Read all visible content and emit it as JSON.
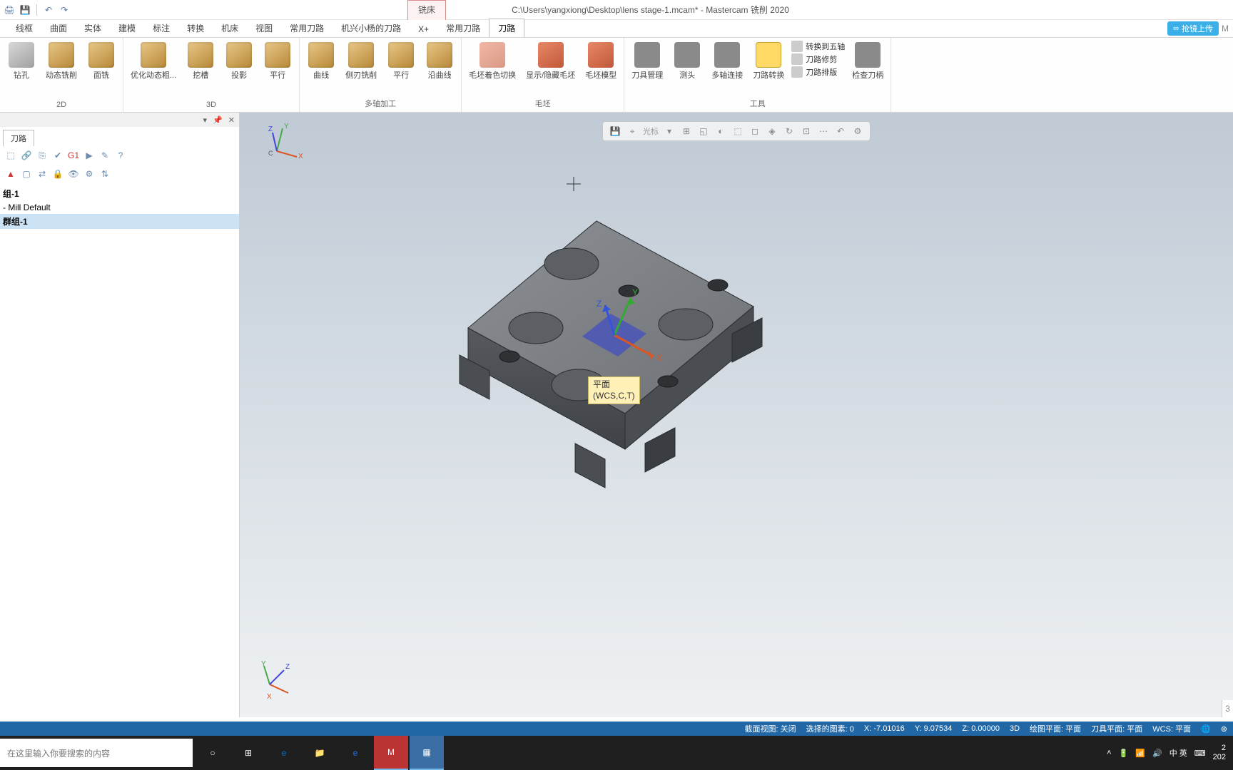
{
  "title": "C:\\Users\\yangxiong\\Desktop\\lens stage-1.mcam* - Mastercam 铣削 2020",
  "context_tab": "铣床",
  "tabs": [
    "线框",
    "曲面",
    "实体",
    "建模",
    "标注",
    "转换",
    "机床",
    "视图",
    "常用刀路",
    "机兴小杨的刀路",
    "X+",
    "常用刀路",
    "刀路"
  ],
  "active_tab": "刀路",
  "upload_button": "抢镜上传",
  "ribbon": {
    "group_2d": {
      "label": "2D",
      "buttons": [
        {
          "label": "钻孔"
        },
        {
          "label": "动态铣削"
        },
        {
          "label": "面铣"
        }
      ]
    },
    "group_3d": {
      "label": "3D",
      "buttons": [
        {
          "label": "优化动态粗..."
        },
        {
          "label": "挖槽"
        },
        {
          "label": "投影"
        },
        {
          "label": "平行"
        }
      ]
    },
    "group_multi": {
      "label": "多轴加工",
      "buttons": [
        {
          "label": "曲线"
        },
        {
          "label": "侧刃铣削"
        },
        {
          "label": "平行"
        },
        {
          "label": "沿曲线"
        }
      ]
    },
    "group_stock": {
      "label": "毛坯",
      "buttons": [
        {
          "label": "毛坯着色切换"
        },
        {
          "label": "显示/隐藏毛坯"
        },
        {
          "label": "毛坯模型"
        }
      ]
    },
    "group_tools": {
      "label": "工具",
      "buttons": [
        {
          "label": "刀具管理"
        },
        {
          "label": "测头"
        },
        {
          "label": "多轴连接"
        },
        {
          "label": "刀路转换"
        }
      ],
      "small": [
        {
          "label": "转换到五轴"
        },
        {
          "label": "刀路修剪"
        },
        {
          "label": "刀路排版"
        }
      ],
      "check": {
        "label": "检查刀柄"
      }
    }
  },
  "panel": {
    "tab": "刀路",
    "tree": [
      {
        "label": "组-1",
        "bold": true
      },
      {
        "label": " - Mill Default"
      },
      {
        "label": "群组-1",
        "bold": true,
        "sel": true
      }
    ]
  },
  "viewport": {
    "plane_label_1": "平面",
    "plane_label_2": "(WCS,C,T)",
    "toolbar_label": "光标",
    "ruler": "3"
  },
  "status": {
    "section_view": "截面视图: 关闭",
    "selected": "选择的图素: 0",
    "x": "X: -7.01016",
    "y": "Y: 9.07534",
    "z": "Z: 0.00000",
    "mode": "3D",
    "cplane": "绘图平面: 平面",
    "tplane": "刀具平面: 平面",
    "wcs": "WCS: 平面"
  },
  "taskbar": {
    "search_placeholder": "在这里输入你要搜索的内容",
    "ime": "中 英",
    "time": "2",
    "date": "202"
  }
}
